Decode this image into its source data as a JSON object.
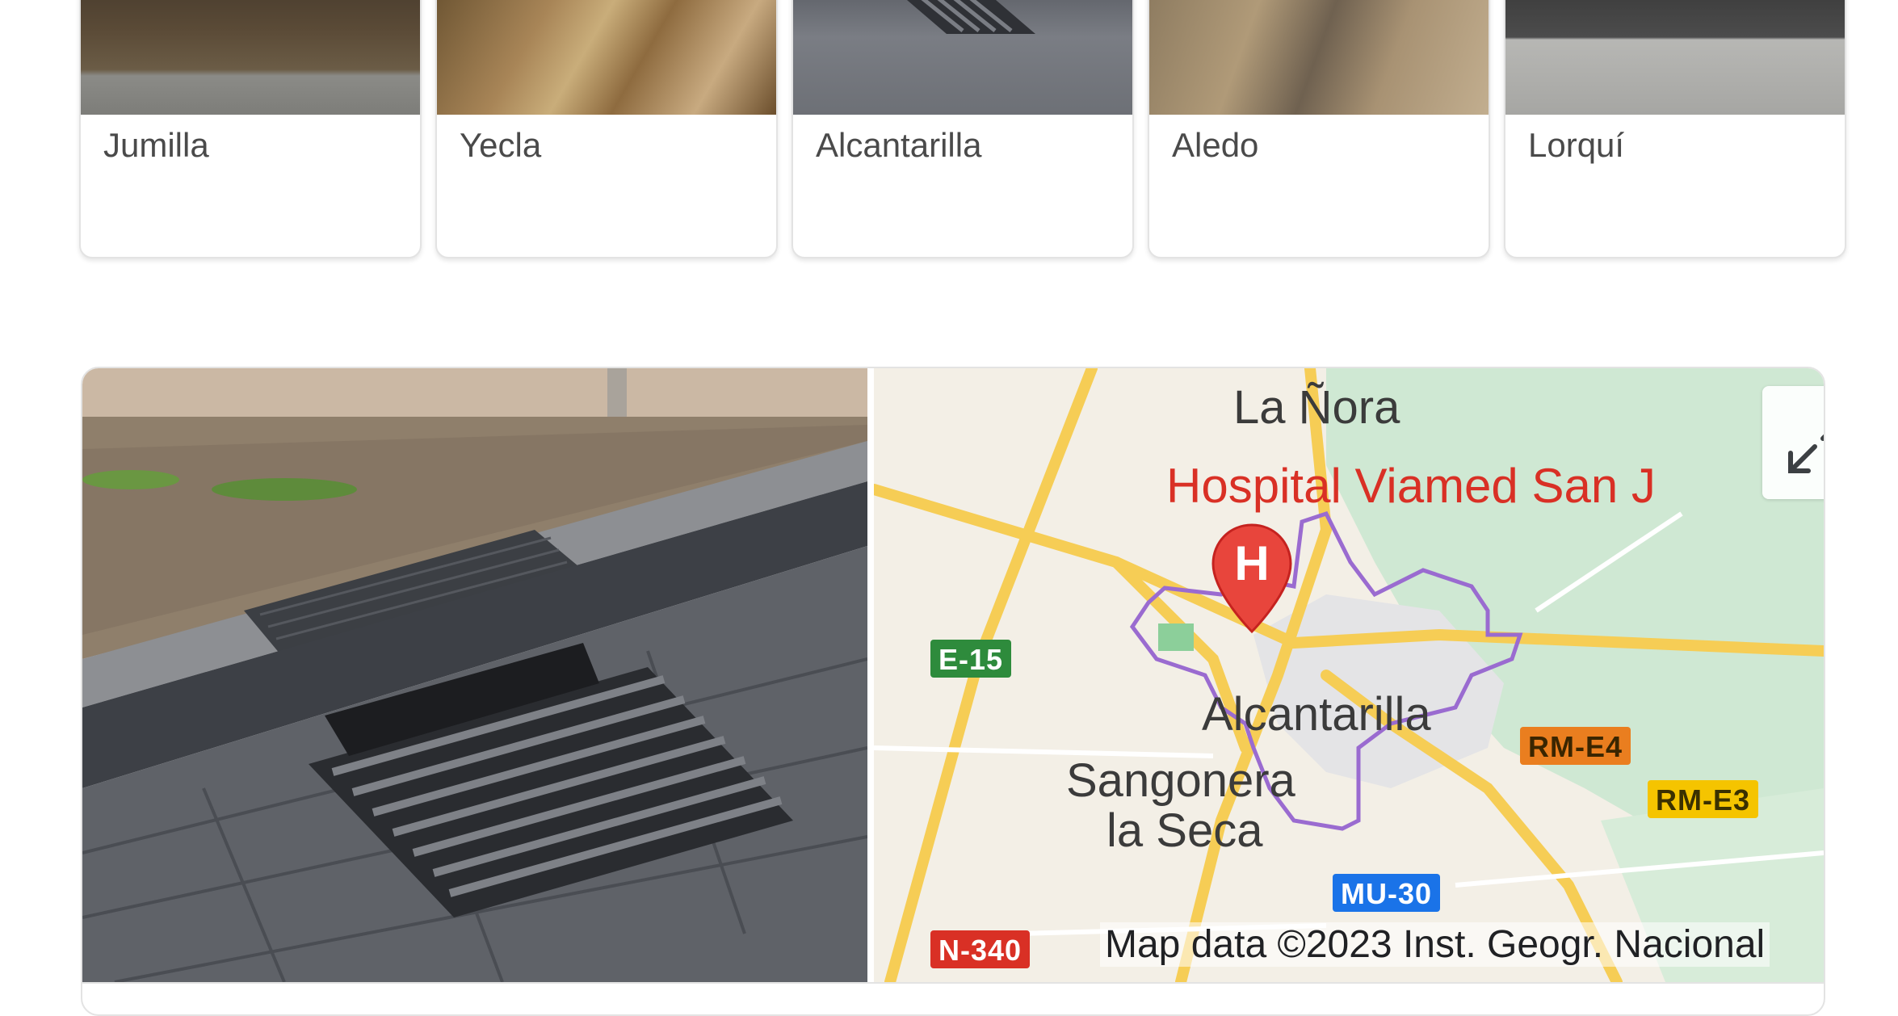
{
  "places": [
    {
      "name": "Jumilla"
    },
    {
      "name": "Yecla"
    },
    {
      "name": "Alcantarilla"
    },
    {
      "name": "Aledo"
    },
    {
      "name": "Lorquí"
    }
  ],
  "map": {
    "labels": {
      "la_nora": "La Ñora",
      "hospital": "Hospital Viamed San J",
      "alcantarilla": "Alcantarilla",
      "sangonera_line1": "Sangonera",
      "sangonera_line2": "la Seca"
    },
    "marker_letter": "H",
    "roads": {
      "e15": "E-15",
      "rme4": "RM-E4",
      "rme3": "RM-E3",
      "mu30": "MU-30",
      "n340": "N-340"
    },
    "attribution": "Map data ©2023 Inst. Geogr. Nacional",
    "colors": {
      "poi": "#d93025",
      "boundary": "#9a6bd0",
      "road": "#f6cd55",
      "park": "#cfe8d3",
      "e15_shield": "#2e8b3c",
      "rme4_shield": "#ea7e1f",
      "rme3_shield": "#f5c400",
      "mu30_shield": "#1a73e8",
      "n340_shield": "#d93025"
    }
  }
}
